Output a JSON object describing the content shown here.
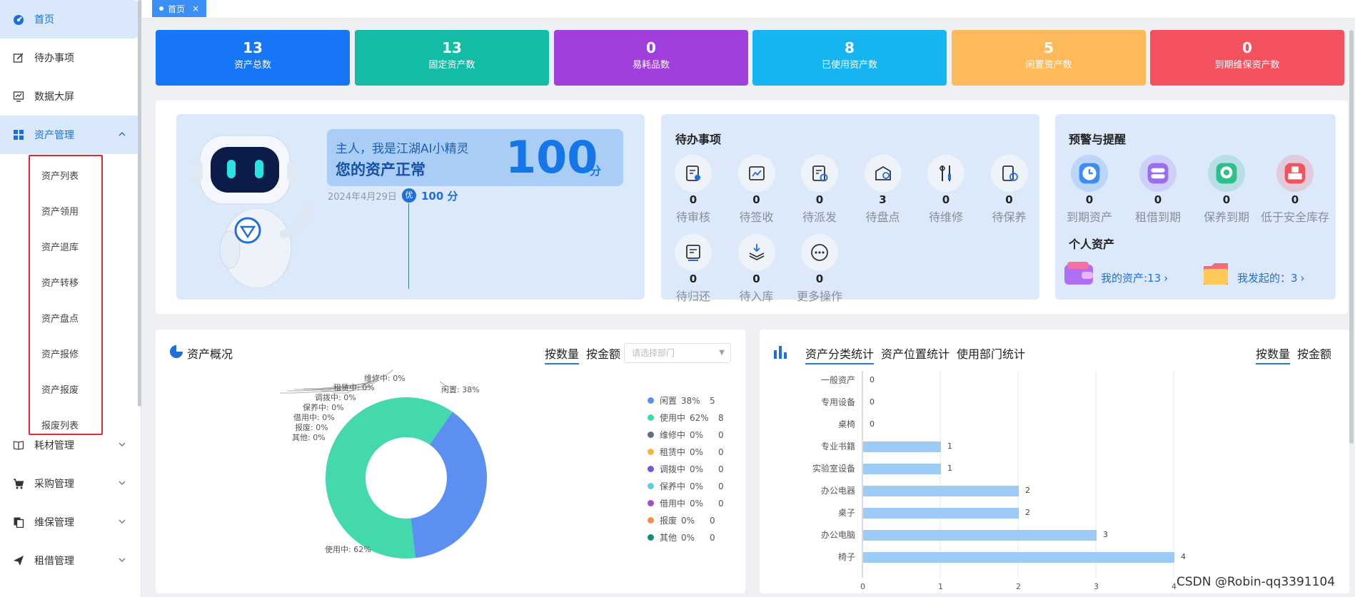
{
  "sidebar": {
    "items": [
      {
        "label": "首页",
        "icon": "dashboard-icon"
      },
      {
        "label": "待办事项",
        "icon": "edit-icon"
      },
      {
        "label": "数据大屏",
        "icon": "monitor-chart-icon"
      },
      {
        "label": "资产管理",
        "icon": "grid-icon"
      },
      {
        "label": "耗材管理",
        "icon": "book-icon"
      },
      {
        "label": "采购管理",
        "icon": "cart-icon"
      },
      {
        "label": "维保管理",
        "icon": "copy-icon"
      },
      {
        "label": "租借管理",
        "icon": "send-icon"
      }
    ],
    "sub_items": [
      "资产列表",
      "资产领用",
      "资产退库",
      "资产转移",
      "资产盘点",
      "资产报修",
      "资产报废",
      "报废列表"
    ]
  },
  "tabs": {
    "home": "首页",
    "close": "×"
  },
  "stats": [
    {
      "value": "13",
      "label": "资产总数",
      "color": "#1676f5"
    },
    {
      "value": "13",
      "label": "固定资产数",
      "color": "#14bba5"
    },
    {
      "value": "0",
      "label": "易耗品数",
      "color": "#a13fdc"
    },
    {
      "value": "8",
      "label": "已使用资产数",
      "color": "#16b5f2"
    },
    {
      "value": "5",
      "label": "闲置资产数",
      "color": "#fdb95a"
    },
    {
      "value": "0",
      "label": "到期维保资产数",
      "color": "#f4515f"
    }
  ],
  "assistant": {
    "greeting": "主人，我是江湖AI小精灵",
    "status": "您的资产正常",
    "score": "100",
    "score_unit": "分",
    "date": "2024年4月29日",
    "grade": "优",
    "grade_score": "100 分"
  },
  "todo": {
    "title": "待办事项",
    "items": [
      {
        "count": "0",
        "label": "待审核",
        "icon": "review-icon"
      },
      {
        "count": "0",
        "label": "待签收",
        "icon": "sign-icon"
      },
      {
        "count": "0",
        "label": "待派发",
        "icon": "dispatch-icon"
      },
      {
        "count": "3",
        "label": "待盘点",
        "icon": "inventory-icon"
      },
      {
        "count": "0",
        "label": "待维修",
        "icon": "repair-icon"
      },
      {
        "count": "0",
        "label": "待保养",
        "icon": "maintain-icon"
      },
      {
        "count": "0",
        "label": "待归还",
        "icon": "return-icon"
      },
      {
        "count": "0",
        "label": "待入库",
        "icon": "stock-in-icon"
      },
      {
        "count": "0",
        "label": "更多操作",
        "icon": "more-icon"
      }
    ]
  },
  "warning": {
    "title": "预警与提醒",
    "items": [
      {
        "count": "0",
        "label": "到期资产",
        "icon": "clock-icon",
        "color": "#3d8ef0"
      },
      {
        "count": "0",
        "label": "租借到期",
        "icon": "swap-icon",
        "color": "#9b6ef0"
      },
      {
        "count": "0",
        "label": "保养到期",
        "icon": "medal-icon",
        "color": "#2fbf8a"
      },
      {
        "count": "0",
        "label": "低于安全库存",
        "icon": "cubes-icon",
        "color": "#f0545e"
      }
    ],
    "personal_title": "个人资产",
    "my_assets": "我的资产:13",
    "my_started": "我发起的：3"
  },
  "overview": {
    "title": "资产概况",
    "toggle": [
      "按数量",
      "按金额"
    ],
    "dept_placeholder": "请选择部门"
  },
  "category": {
    "tabs": [
      "资产分类统计",
      "资产位置统计",
      "使用部门统计"
    ],
    "toggle": [
      "按数量",
      "按金额"
    ]
  },
  "chart_data": [
    {
      "type": "pie",
      "slices": [
        {
          "name": "闲置",
          "value": 5,
          "percent": "38%",
          "color": "#5b8ff0"
        },
        {
          "name": "使用中",
          "value": 8,
          "percent": "62%",
          "color": "#44d9ad"
        },
        {
          "name": "维修中",
          "value": 0,
          "percent": "0%",
          "color": "#5d6f8a"
        },
        {
          "name": "租赁中",
          "value": 0,
          "percent": "0%",
          "color": "#f5b63f"
        },
        {
          "name": "调拨中",
          "value": 0,
          "percent": "0%",
          "color": "#6f59e0"
        },
        {
          "name": "保养中",
          "value": 0,
          "percent": "0%",
          "color": "#5ecbea"
        },
        {
          "name": "借用中",
          "value": 0,
          "percent": "0%",
          "color": "#a04fc9"
        },
        {
          "name": "报废",
          "value": 0,
          "percent": "0%",
          "color": "#f48e4b"
        },
        {
          "name": "其他",
          "value": 0,
          "percent": "0%",
          "color": "#138a82"
        }
      ],
      "outer_labels": [
        {
          "text": "闲置: 38%"
        },
        {
          "text": "维修中: 0%"
        },
        {
          "text": "租赁中: 0%"
        },
        {
          "text": "调拨中: 0%"
        },
        {
          "text": "保养中: 0%"
        },
        {
          "text": "借用中: 0%"
        },
        {
          "text": "报废: 0%"
        },
        {
          "text": "其他: 0%"
        },
        {
          "text": "使用中: 62%"
        }
      ]
    },
    {
      "type": "bar",
      "orientation": "horizontal",
      "categories": [
        "一般资产",
        "专用设备",
        "桌椅",
        "专业书籍",
        "实验室设备",
        "办公电器",
        "桌子",
        "办公电脑",
        "椅子"
      ],
      "values": [
        0,
        0,
        0,
        1,
        1,
        2,
        2,
        3,
        4
      ],
      "xlim": [
        0,
        4
      ],
      "xticks": [
        "0",
        "1",
        "2",
        "3",
        "4"
      ],
      "color": "#9ecbf5"
    }
  ],
  "watermark": "CSDN @Robin-qq3391104"
}
